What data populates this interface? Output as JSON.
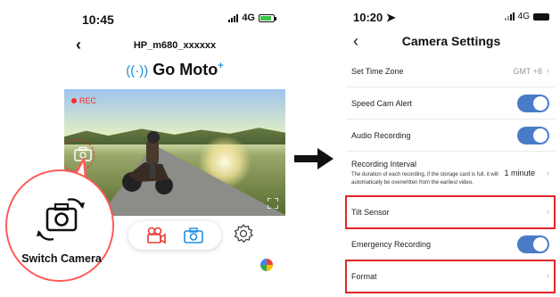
{
  "left_phone": {
    "status_time": "10:45",
    "status_signal": "4G",
    "nav_title": "HP_m680_xxxxxx",
    "brand": "Go Moto",
    "brand_sup": "+",
    "rec_label": "REC",
    "icons": {
      "back": "chevron-left-icon",
      "switch": "camera-switch-icon",
      "record": "video-record-icon",
      "photo": "camera-icon",
      "settings": "gear-icon",
      "fullscreen": "fullscreen-icon",
      "map": "map-icon"
    }
  },
  "callout": {
    "label": "Switch Camera",
    "border_color": "#ff5a5a"
  },
  "right_phone": {
    "status_time": "10:20",
    "status_signal": "4G",
    "title": "Camera Settings",
    "accent": "#4a7bc7",
    "highlight_color": "#e0262a",
    "rows": [
      {
        "label": "Set Time Zone",
        "value": "GMT +8"
      },
      {
        "label": "Speed Cam Alert",
        "toggle": true
      },
      {
        "label": "Audio Recording",
        "toggle": true
      },
      {
        "label": "Recording Interval",
        "sub": "The duration of each recording, if the storage card is full, it will automatically be overwritten from the earliest video.",
        "value": "1 minute"
      },
      {
        "label": "Tilt Sensor",
        "highlighted": true
      },
      {
        "label": "Emergency Recording",
        "toggle": true
      },
      {
        "label": "Format",
        "highlighted": true
      }
    ]
  }
}
